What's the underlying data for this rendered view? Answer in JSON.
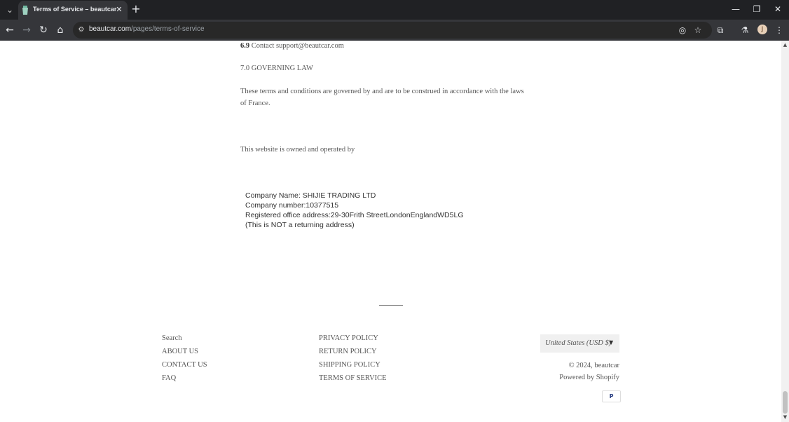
{
  "browser": {
    "tab": {
      "title": "Terms of Service – beautcar"
    },
    "address_bar": {
      "host": "beautcar.com",
      "path": "/pages/terms-of-service"
    },
    "icons": [
      "tab-list-icon",
      "favicon-icon",
      "close-icon",
      "plus-icon",
      "minimize-icon",
      "restore-icon",
      "window-close-icon",
      "back-icon",
      "forward-icon",
      "reload-icon",
      "home-icon",
      "site-info-icon",
      "eye-off-icon",
      "star-icon",
      "extensions-icon",
      "labs-icon",
      "profile-avatar",
      "menu-icon"
    ],
    "avatar_letter": "J"
  },
  "content": {
    "contact_num": "6.9",
    "contact_text": " Contact support@beautcar.com",
    "governing_heading": "7.0 GOVERNING LAW",
    "governing_line1": "These terms and conditions are governed by and are to be construed in accordance with the laws",
    "governing_line2": "of France.",
    "owned_by": "This website is owned and operated by",
    "company_name": "Company Name: SHIJIE TRADING LTD",
    "company_number": "Company number:10377515",
    "registered_office": "Registered office address:29-30Frith StreetLondonEnglandWD5LG",
    "not_returning": "(This is NOT a returning address)"
  },
  "footer": {
    "col1": [
      "Search",
      "ABOUT US",
      "CONTACT US",
      "FAQ"
    ],
    "col2": [
      "PRIVACY POLICY",
      "RETURN POLICY",
      "SHIPPING POLICY",
      "TERMS OF SERVICE"
    ],
    "currency": "United States (USD $)",
    "copyright": "© 2024, beautcar",
    "powered_by": "Powered by Shopify",
    "payment": "P"
  },
  "colors": {
    "chrome_dark": "#202124",
    "toolbar": "#35363a",
    "text": "#555555"
  }
}
